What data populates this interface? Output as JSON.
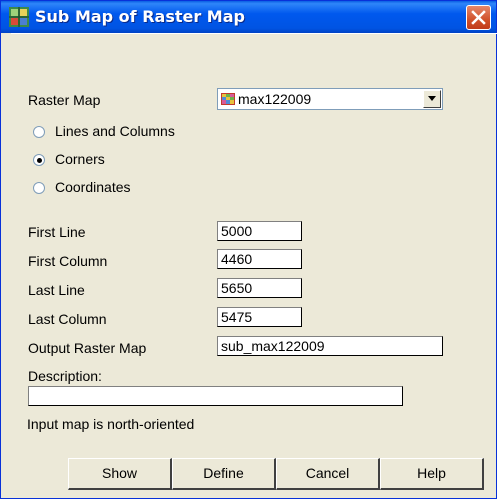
{
  "window": {
    "title": "Sub Map of Raster Map"
  },
  "raster_map": {
    "label": "Raster Map",
    "selected": "max122009"
  },
  "mode_options": [
    {
      "label": "Lines and Columns",
      "selected": false
    },
    {
      "label": "Corners",
      "selected": true
    },
    {
      "label": "Coordinates",
      "selected": false
    }
  ],
  "fields": {
    "first_line": {
      "label": "First Line",
      "value": "5000"
    },
    "first_column": {
      "label": "First Column",
      "value": "4460"
    },
    "last_line": {
      "label": "Last Line",
      "value": "5650"
    },
    "last_column": {
      "label": "Last Column",
      "value": "5475"
    },
    "output_map": {
      "label": "Output Raster Map",
      "value": "sub_max122009"
    },
    "description": {
      "label": "Description:",
      "value": ""
    }
  },
  "status": {
    "text": "Input map is north-oriented"
  },
  "buttons": {
    "show": "Show",
    "define": "Define",
    "cancel": "Cancel",
    "help": "Help"
  }
}
